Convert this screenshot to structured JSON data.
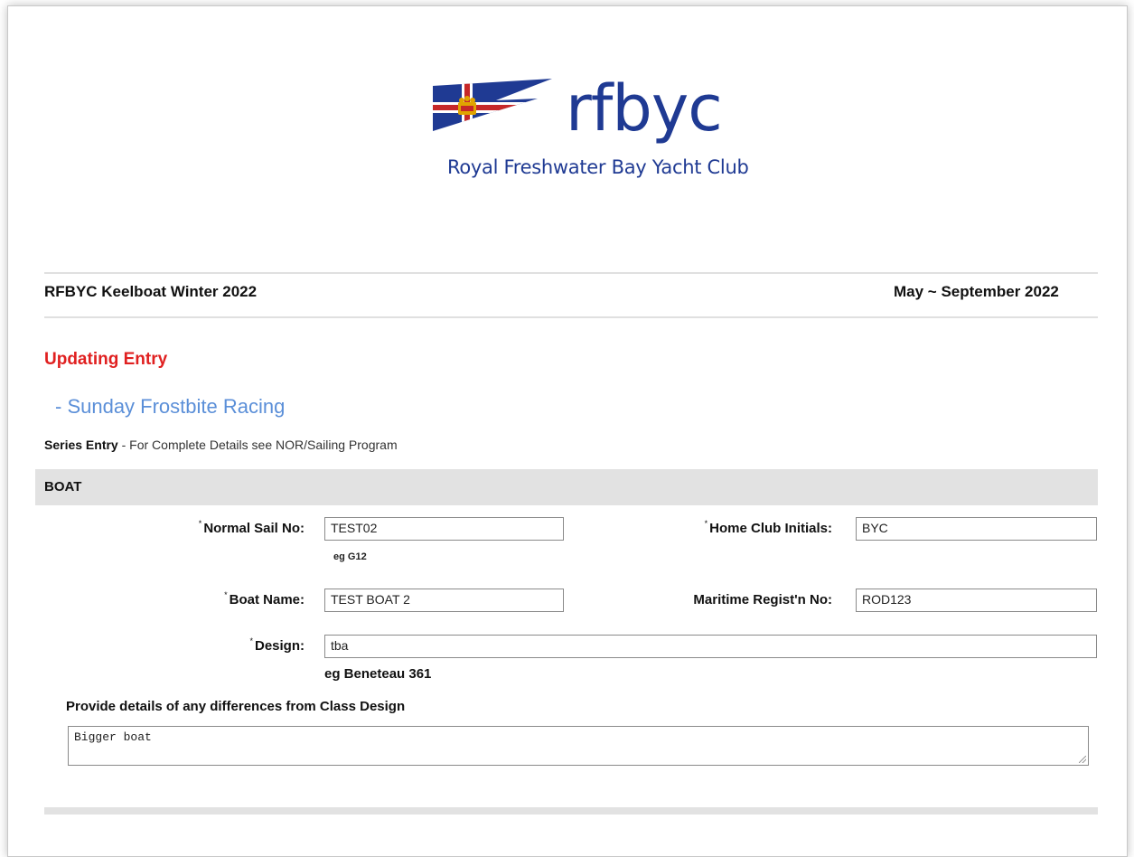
{
  "logo": {
    "name": "rfbyc",
    "subtitle": "Royal Freshwater Bay Yacht Club",
    "colors": {
      "brand": "#1f3a93",
      "flag_red": "#c62828",
      "crown_gold": "#e0a400"
    }
  },
  "event": {
    "title": "RFBYC Keelboat Winter 2022",
    "dates": "May ~ September 2022"
  },
  "status": {
    "text": "Updating Entry",
    "color": "#e02020"
  },
  "series": {
    "name": "- Sunday Frostbite Racing",
    "entry_bold": "Series Entry",
    "entry_rest": " - For Complete Details see NOR/Sailing Program"
  },
  "section": {
    "title": "BOAT"
  },
  "form": {
    "required_mark": "*",
    "sail_no": {
      "label": "Normal Sail No:",
      "value": "TEST02",
      "hint": "eg G12"
    },
    "home_club": {
      "label": "Home Club Initials:",
      "value": "BYC"
    },
    "boat_name": {
      "label": "Boat Name:",
      "value": "TEST BOAT 2"
    },
    "maritime": {
      "label": "Maritime Regist'n No:",
      "value": "ROD123"
    },
    "design": {
      "label": "Design:",
      "value": "tba",
      "hint": "eg Beneteau 361"
    },
    "differences": {
      "label": "Provide details of any differences from Class Design",
      "value": "Bigger boat"
    }
  }
}
